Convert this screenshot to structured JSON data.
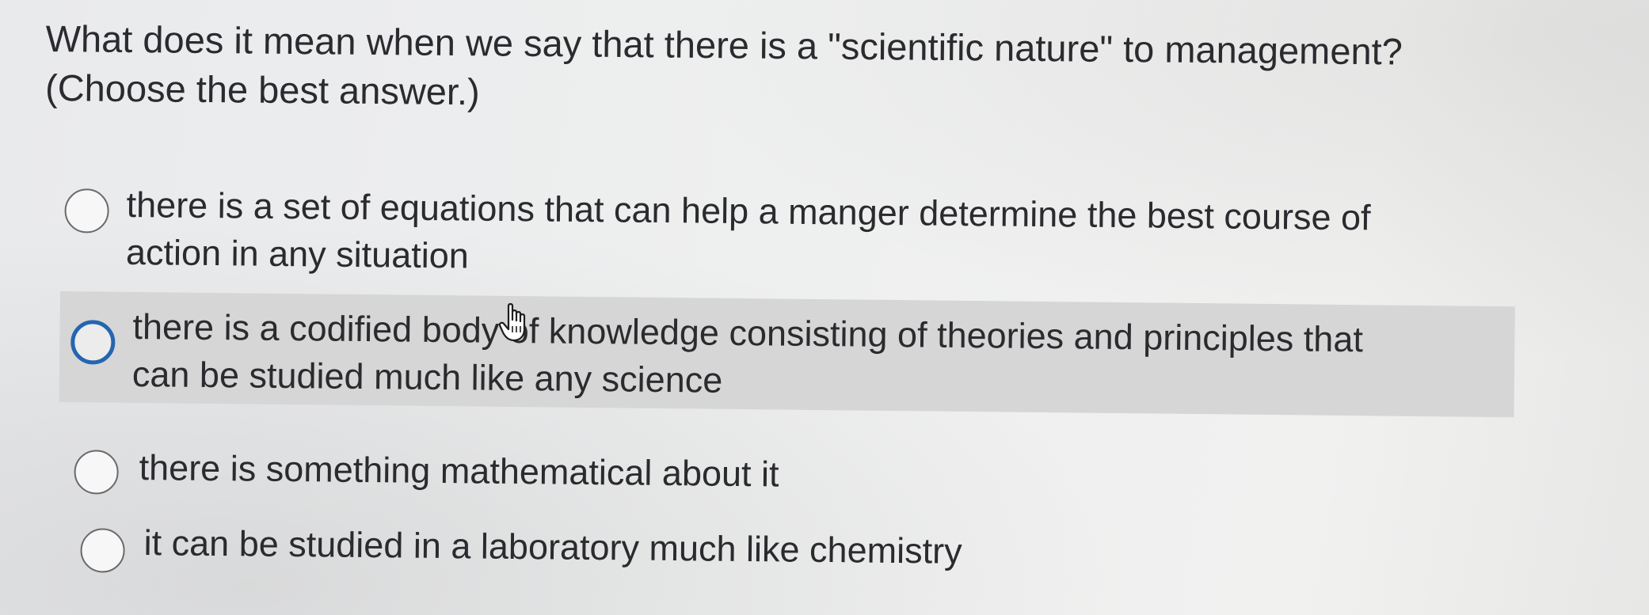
{
  "question": {
    "line1": "What does it mean when we say that there is a \"scientific nature\" to management?",
    "line2": "(Choose the best answer.)"
  },
  "options": [
    {
      "line1": "there is a set of equations that can help a manger determine the best course of",
      "line2": "action in any situation",
      "selected": false
    },
    {
      "line1": "there is a codified body of knowledge consisting of theories and principles that",
      "line2": "can be studied much like any science",
      "selected": true
    },
    {
      "line1": "there is something mathematical about it",
      "selected": false
    },
    {
      "line1": "it can be studied in a laboratory much like chemistry",
      "selected": false
    }
  ],
  "colors": {
    "selection_ring": "#2565b0",
    "hover_background": "#d6d6d6"
  },
  "icons": {
    "cursor": "pointer-hand-icon"
  }
}
